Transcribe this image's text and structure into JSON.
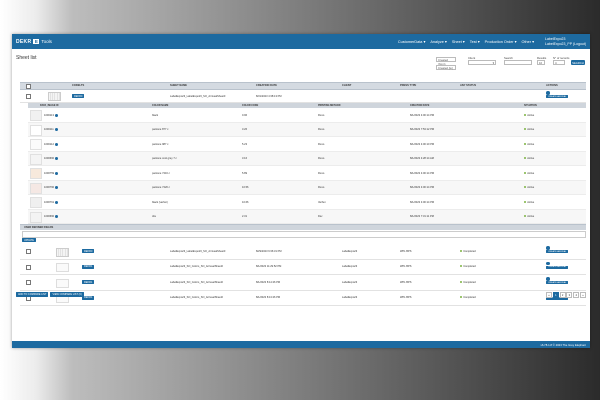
{
  "brand": {
    "name": "DEKR",
    "box": "E",
    "sub": "Tools"
  },
  "nav": [
    "CustomerData ▾",
    "Analyze ▾",
    "Sheet ▾",
    "Test ▾",
    "Production Order ▾",
    "Other ▾"
  ],
  "user": {
    "line1": "LabelExpo23",
    "line2": "LabelExpo23_PP (Logout)"
  },
  "page_title": "Sheet list",
  "filters": {
    "created_from": "Created (from)",
    "created_to": "Created (to)",
    "client_label": "Client",
    "search_label": "Search",
    "results_label": "Results",
    "results_value": "10",
    "records_label": "N° of records",
    "records_value": "4",
    "search_button": "SEARCH"
  },
  "columns": [
    "",
    "CODELTS",
    "SHEET NAME",
    "CREATION DATE",
    "CLIENT",
    "PRESS TYPE",
    "ANY STATUS",
    "ACTIONS"
  ],
  "main_rows": [
    {
      "btn": "DEKR0",
      "name": "LabelExpo23_LabelExpo23_SO_ArrivealSheet0",
      "date": "8/31/2023 4:38:13 PM",
      "client": "",
      "press": "",
      "status": "",
      "action": "CREATE ARRIVAL"
    },
    {
      "btn": "DEKR0",
      "name": "LabelExpo23_LabelExpo23_SO_ArrivealSheet0",
      "date": "8/29/2023 9:36:31 PM",
      "client": "LabelExpo23",
      "press": "WPL BPS",
      "status": "Completed",
      "action": "CREATE ARRIVAL"
    },
    {
      "btn": "DEKR1",
      "name": "LabelExpo23_SO_Colors_SO_ArrivealSheet0",
      "date": "8/1/2023 11:29:52 PM",
      "client": "LabelExpo23",
      "press": "WPL BPS",
      "status": "Completed",
      "action": "CREATE ARRIVAL"
    },
    {
      "btn": "DEKR1",
      "name": "LabelExpo23_SO_Colors_SO_ArrivealSheet0",
      "date": "8/1/2023 8:14:26 PM",
      "client": "LabelExpo23",
      "press": "WPL BPS",
      "status": "Completed",
      "action": "CREATE ARRIVAL"
    },
    {
      "btn": "DEKR1",
      "name": "LabelExpo23_SO_Colors_SO_ArrivealSheet0",
      "date": "8/1/2023 8:13:26 PM",
      "client": "LabelExpo23",
      "press": "WPL BPS",
      "status": "Completed",
      "action": "CREATE ARRIVAL"
    }
  ],
  "sub_columns": [
    "DATA_IMAGE ID",
    "COLOR NAME",
    "COLOR CODE",
    "PRINTING METHOD",
    "CREATION DATE",
    "SITUATION"
  ],
  "sub_rows": [
    {
      "id": "1000113",
      "name": "black",
      "code": "0.96",
      "method": "Flexo",
      "date": "8/1/2023 4:00:14 PM",
      "status": "Active",
      "color": "#f1f1f1"
    },
    {
      "id": "1000111",
      "name": "pantone 877 c",
      "code": "3.26",
      "method": "Flexo",
      "date": "8/1/2023 7:53:12 PM",
      "status": "Active",
      "color": "#ffffff"
    },
    {
      "id": "1000112",
      "name": "pantone 987 c",
      "code": "5.23",
      "method": "Flexo",
      "date": "8/1/2023 4:00:10 PM",
      "status": "Active",
      "color": "#fbfbfb"
    },
    {
      "id": "1000660",
      "name": "pantone cool grey 7 c",
      "code": "3.16",
      "method": "Flexo",
      "date": "8/1/2023 4:28:14 AM",
      "status": "Active",
      "color": "#f4f4f4"
    },
    {
      "id": "1000759",
      "name": "pantone 7416 c",
      "code": "5.89",
      "method": "Flexo",
      "date": "8/1/2023 4:00:14 PM",
      "status": "Active",
      "color": "#f7e9dc"
    },
    {
      "id": "1000760",
      "name": "pantone 7420 c",
      "code": "10.56",
      "method": "Flexo",
      "date": "8/1/2023 4:00:14 PM",
      "status": "Active",
      "color": "#f5e8e4"
    },
    {
      "id": "1000761",
      "name": "black (varhet)",
      "code": "10.66",
      "method": "Varhet",
      "date": "8/1/2023 4:00:14 PM",
      "status": "Active",
      "color": "#efefef"
    },
    {
      "id": "1000660",
      "name": "dsv",
      "code": "2.31",
      "method": "Dsv",
      "date": "8/1/2023 7:31:11 PM",
      "status": "Active",
      "color": "#f3f3f3"
    }
  ],
  "udf_label": "USER DEFINED FIELDS",
  "udf_button": "UPDATE",
  "bottom_buttons": [
    "ADD TO COMPARE LIST",
    "VIEW COMPARE LIST (0)"
  ],
  "pager": [
    "«",
    "1",
    "2",
    "3",
    "4",
    "»"
  ],
  "footer": "v6.78.1.8 © 2023 The Grey Elephant"
}
